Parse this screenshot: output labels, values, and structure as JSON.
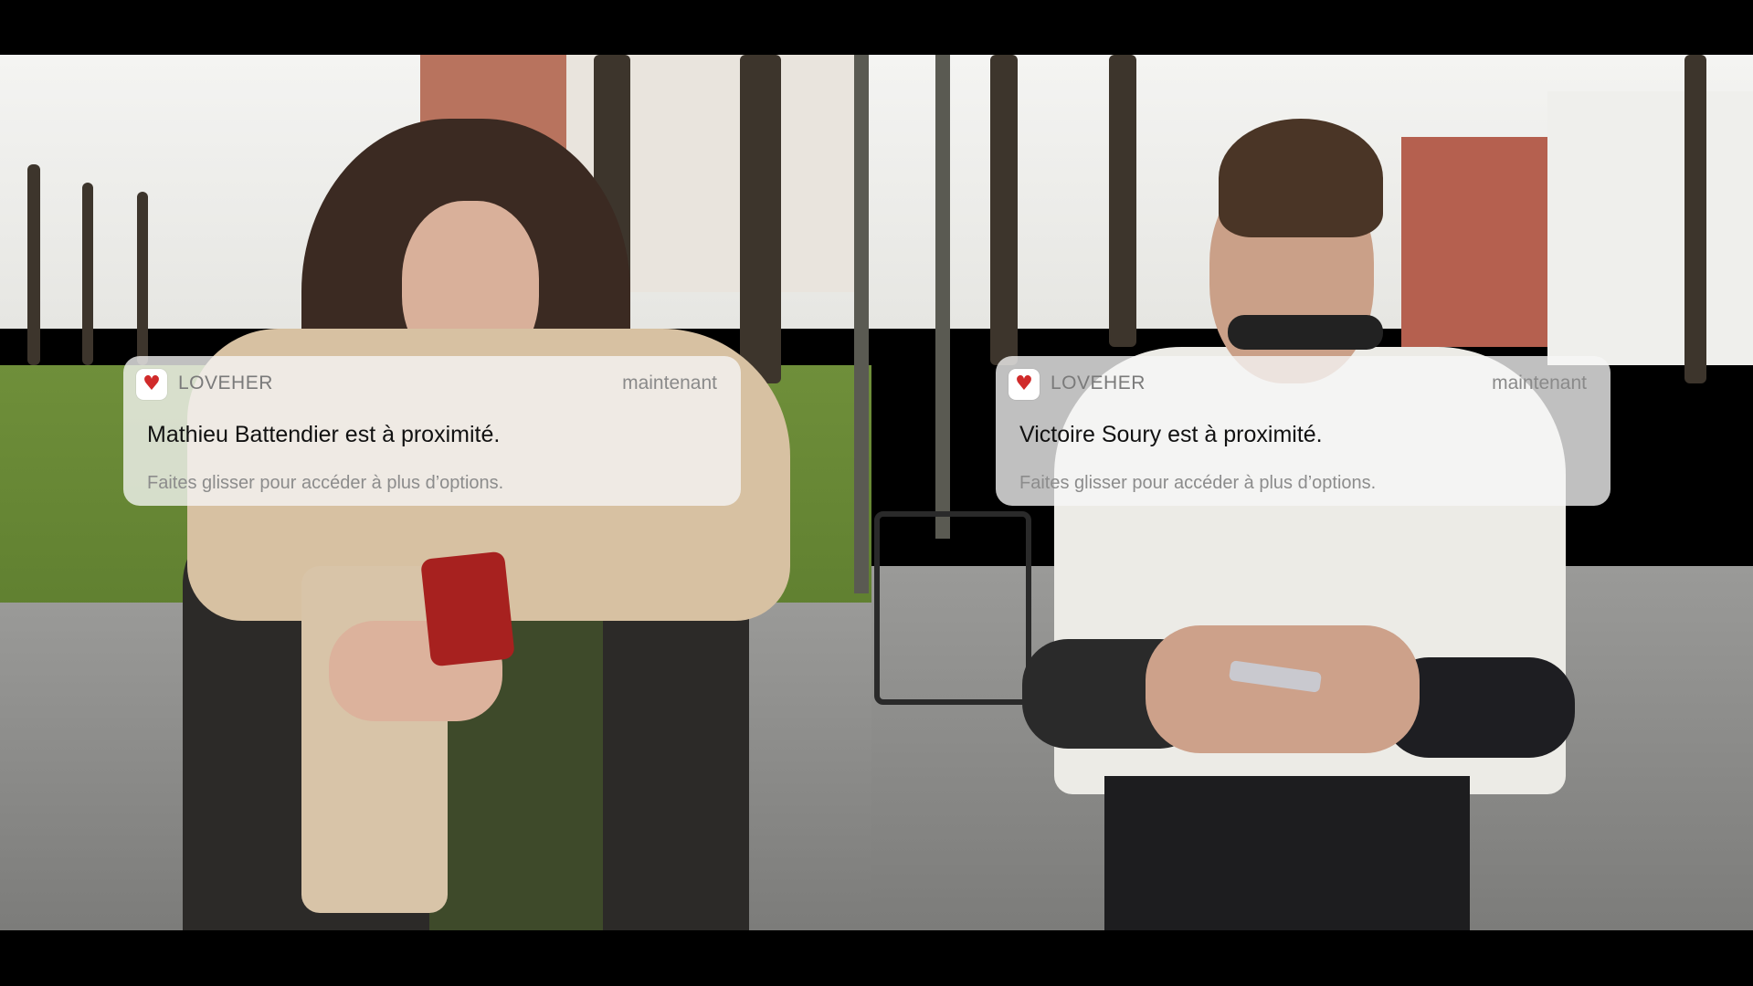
{
  "notifications": [
    {
      "app_name": "LOVEHER",
      "time": "maintenant",
      "title": "Mathieu Battendier est à proximité.",
      "hint": "Faites glisser pour accéder à plus d’options.",
      "icon": "heart-icon"
    },
    {
      "app_name": "LOVEHER",
      "time": "maintenant",
      "title": "Victoire Soury est à proximité.",
      "hint": "Faites glisser pour accéder à plus d’options.",
      "icon": "heart-icon"
    }
  ],
  "colors": {
    "accent": "#d02a2a",
    "notification_bg": "#f6f6f6"
  }
}
